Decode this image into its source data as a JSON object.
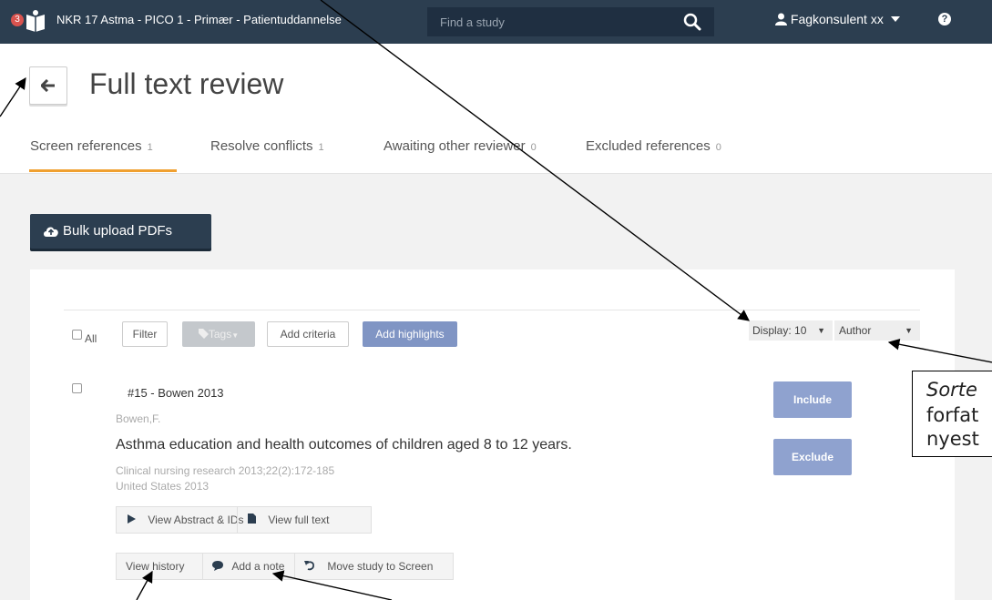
{
  "topbar": {
    "notification_count": "3",
    "app_title": "NKR 17 Astma - PICO 1 - Primær - Patientuddannelse",
    "search_placeholder": "Find a study",
    "user_name": "Fagkonsulent xx",
    "help_label": "?"
  },
  "header": {
    "page_title": "Full text review"
  },
  "tabs": [
    {
      "label": "Screen references",
      "count": "1",
      "active": true
    },
    {
      "label": "Resolve conflicts",
      "count": "1"
    },
    {
      "label": "Awaiting other reviewer",
      "count": "0"
    },
    {
      "label": "Excluded references",
      "count": "0"
    }
  ],
  "bulk_upload_label": "Bulk upload PDFs",
  "toolbar": {
    "all_label": "All",
    "filter_label": "Filter",
    "tags_label": "Tags",
    "add_criteria_label": "Add criteria",
    "add_highlights_label": "Add highlights",
    "display_value": "Display: 10",
    "sort_value": "Author"
  },
  "reference": {
    "title": "#15 - Bowen 2013",
    "author": "Bowen,F.",
    "heading": "Asthma education and health outcomes of children aged 8 to 12 years.",
    "journal": "Clinical nursing research 2013;22(2):172-185",
    "country_year": "United States 2013",
    "include_label": "Include",
    "exclude_label": "Exclude",
    "view_abstract_label": "View Abstract & IDs",
    "view_full_text_label": "View full text",
    "view_history_label": "View history",
    "add_note_label": "Add a note",
    "move_study_label": "Move study to Screen"
  },
  "annotation": {
    "line1": "Sorte",
    "line2": "forfat",
    "line3": "nyest"
  },
  "colors": {
    "topbar": "#2c3e50",
    "tab_underline": "#f0a030",
    "action_button": "#8fa2cf",
    "primary_button": "#8095c4"
  }
}
